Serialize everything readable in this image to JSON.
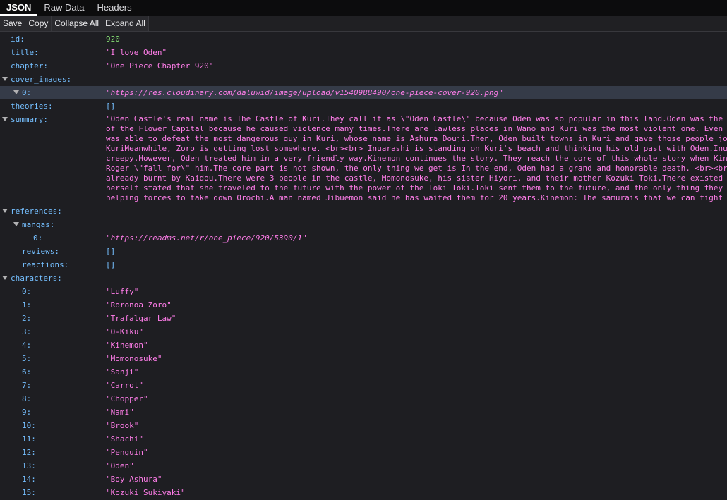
{
  "tabs": [
    "JSON",
    "Raw Data",
    "Headers"
  ],
  "toolbar": [
    "Save",
    "Copy",
    "Collapse All",
    "Expand All"
  ],
  "fields": {
    "id_key": "id:",
    "id_val": "920",
    "title_key": "title:",
    "title_val": "\"I love Oden\"",
    "chapter_key": "chapter:",
    "chapter_val": "\"One Piece Chapter 920\"",
    "cover_key": "cover_images:",
    "cover0_key": "0:",
    "cover0_val": "\"https://res.cloudinary.com/daluwid/image/upload/v1540988490/one-piece-cover-920.png\"",
    "theories_key": "theories:",
    "theories_val": "[]",
    "summary_key": "summary:",
    "references_key": "references:",
    "mangas_key": "mangas:",
    "manga0_key": "0:",
    "manga0_val": "\"https://readms.net/r/one_piece/920/5390/1\"",
    "reviews_key": "reviews:",
    "reviews_val": "[]",
    "reactions_key": "reactions:",
    "reactions_val": "[]",
    "characters_key": "characters:"
  },
  "summary_lines": [
    "\"Oden Castle's real name is The Castle of Kuri.They call it as \\\"Oden Castle\\\" because Oden was so popular in this land.Oden was the",
    "of the Flower Capital because he caused violence many times.There are lawless places in Wano and Kuri was the most violent one. Even",
    "was able to defeat the most dangerous guy in Kuri, whose name is Ashura Douji.Then, Oden built towns in Kuri and gave those people jo",
    "KuriMeanwhile, Zoro is getting lost somewhere. <br><br> Inuarashi is standing on Kuri's beach and thinking his old past with Oden.Inu",
    "creepy.However, Oden treated him in a very friendly way.Kinemon continues the story. They reach the core of this whole story when Kin",
    "Roger \\\"fall for\\\" him.The core part is not shown, the only thing we get is In the end, Oden had a grand and honorable death. <br><br",
    "already burnt by Kaidou.There were 3 people in the castle, Momonosuke, his sister Hiyori, and their mother Kozuki Toki.There existed",
    "herself stated that she traveled to the future with the power of the Toki Toki.Toki sent them to the future, and the only thing they",
    "helping forces to take down Orochi.A man named Jibuemon said he has waited them for 20 years.Kinemon: The samurais that we can fight"
  ],
  "characters": [
    {
      "key": "0:",
      "val": "\"Luffy\""
    },
    {
      "key": "1:",
      "val": "\"Roronoa Zoro\""
    },
    {
      "key": "2:",
      "val": "\"Trafalgar Law\""
    },
    {
      "key": "3:",
      "val": "\"O-Kiku\""
    },
    {
      "key": "4:",
      "val": "\"Kinemon\""
    },
    {
      "key": "5:",
      "val": "\"Momonosuke\""
    },
    {
      "key": "6:",
      "val": "\"Sanji\""
    },
    {
      "key": "7:",
      "val": "\"Carrot\""
    },
    {
      "key": "8:",
      "val": "\"Chopper\""
    },
    {
      "key": "9:",
      "val": "\"Nami\""
    },
    {
      "key": "10:",
      "val": "\"Brook\""
    },
    {
      "key": "11:",
      "val": "\"Shachi\""
    },
    {
      "key": "12:",
      "val": "\"Penguin\""
    },
    {
      "key": "13:",
      "val": "\"Oden\""
    },
    {
      "key": "14:",
      "val": "\"Boy Ashura\""
    },
    {
      "key": "15:",
      "val": "\"Kozuki Sukiyaki\""
    }
  ],
  "colors": {
    "background": "#1e1e22",
    "key": "#75bfff",
    "string": "#ff7de9",
    "number": "#86de74",
    "selected_row": "#353b48"
  }
}
